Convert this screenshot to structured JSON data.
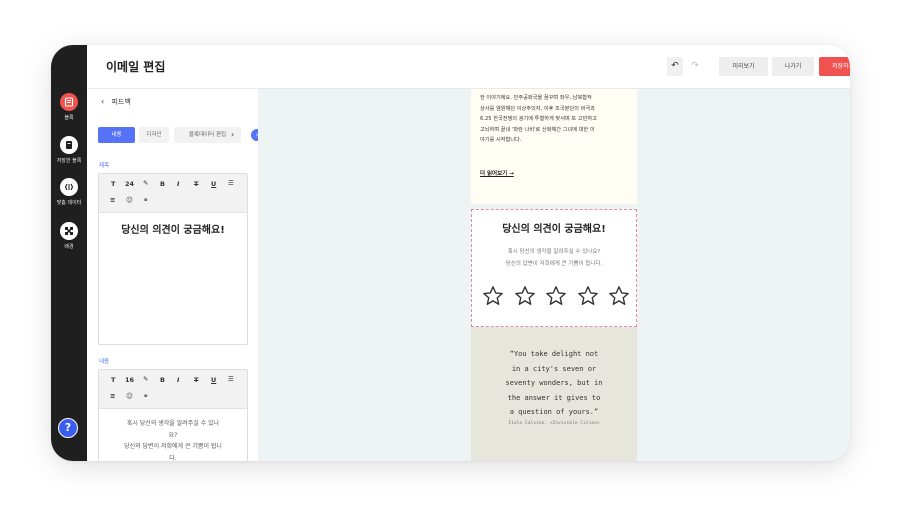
{
  "sidebar": {
    "items": [
      {
        "label": "블록",
        "icon": "blocks-icon",
        "color": "#ef5350"
      },
      {
        "label": "저장한 블록",
        "icon": "saved-block-icon",
        "color": "#ffffff"
      },
      {
        "label": "맞춤 데이터",
        "icon": "custom-data-icon",
        "color": "#ffffff"
      },
      {
        "label": "배경",
        "icon": "background-icon",
        "color": "#ffffff"
      }
    ],
    "help": "?"
  },
  "header": {
    "title": "이메일 편집",
    "undo": "↶",
    "redo": "↷",
    "preview": "미리보기",
    "exit": "나가기",
    "save": "저장하기"
  },
  "panel": {
    "back_label": "피드백",
    "tabs": [
      "내용",
      "디자인",
      "블록데이터 편집"
    ],
    "title_label": "제목",
    "title_toolbar_size": "24",
    "title_text": "당신의 의견이 궁금해요!",
    "content_label": "내용",
    "content_toolbar_size": "16",
    "content_text_1": "혹시 당신의 생각을 알려주실 수 있나",
    "content_text_2": "요?",
    "content_text_3": "당신의 답변이 저희에게 큰 기쁨이 됩니",
    "content_text_4": "다."
  },
  "email": {
    "story_lines": [
      "한 이야기에요. 민주공화국을 꿈꾸며 좌우, 남북합작",
      "상사를 염원해던 이상주의자, 이후 조국분단의 비극과",
      "6.25 한국전쟁의 광기에 투철하게 맞서며 또 고민하고",
      "고뇌하며 끝내 '파란 나비'로 산화해간 그녀에 대한 이",
      "야기를 시작합니다."
    ],
    "more": "더 읽어보기 →",
    "survey_title": "당신의 의견이 궁금해요!",
    "survey_sub_1": "혹시 당신의 생각을 알려주실 수 있나요?",
    "survey_sub_2": "당신의 답변이 저희에게 큰 기쁨이 됩니다.",
    "star_count": 5,
    "quote_lines": [
      "“You take delight not",
      "in a city's seven or",
      "seventy wonders, but in",
      "the answer it gives to",
      "a question of yours.”"
    ],
    "quote_source": "Italo Calvino, <Invisible Cities>"
  },
  "colors": {
    "accent": "#5672f6",
    "save": "#ef5350",
    "sidebar": "#1f1f1f"
  }
}
